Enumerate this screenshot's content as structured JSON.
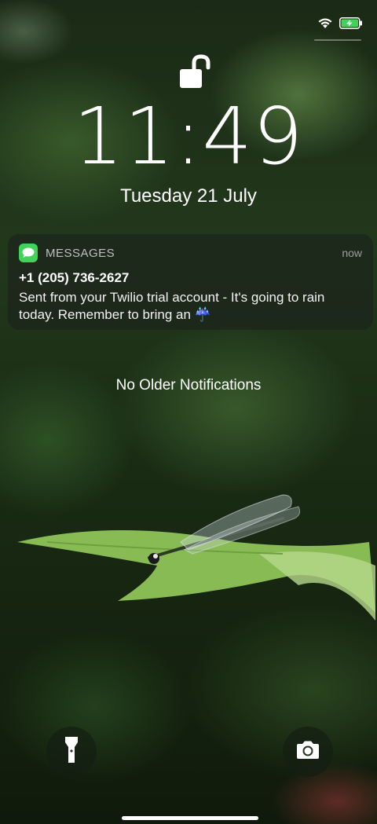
{
  "status": {
    "wifi_icon": "wifi-icon",
    "battery_icon": "battery-charging-icon",
    "battery_color": "#3fd35a"
  },
  "lock": {
    "icon": "unlocked-padlock-icon"
  },
  "clock": {
    "time": "11:49",
    "date": "Tuesday 21 July"
  },
  "notification": {
    "app_name": "MESSAGES",
    "time": "now",
    "sender": "+1 (205) 736-2627",
    "body": "Sent from your Twilio trial account - It's going to rain today. Remember to bring an ☔",
    "app_icon": "messages-icon",
    "app_color": "#3fd35a"
  },
  "no_older_text": "No Older Notifications",
  "controls": {
    "left_icon": "flashlight-icon",
    "right_icon": "camera-icon"
  }
}
